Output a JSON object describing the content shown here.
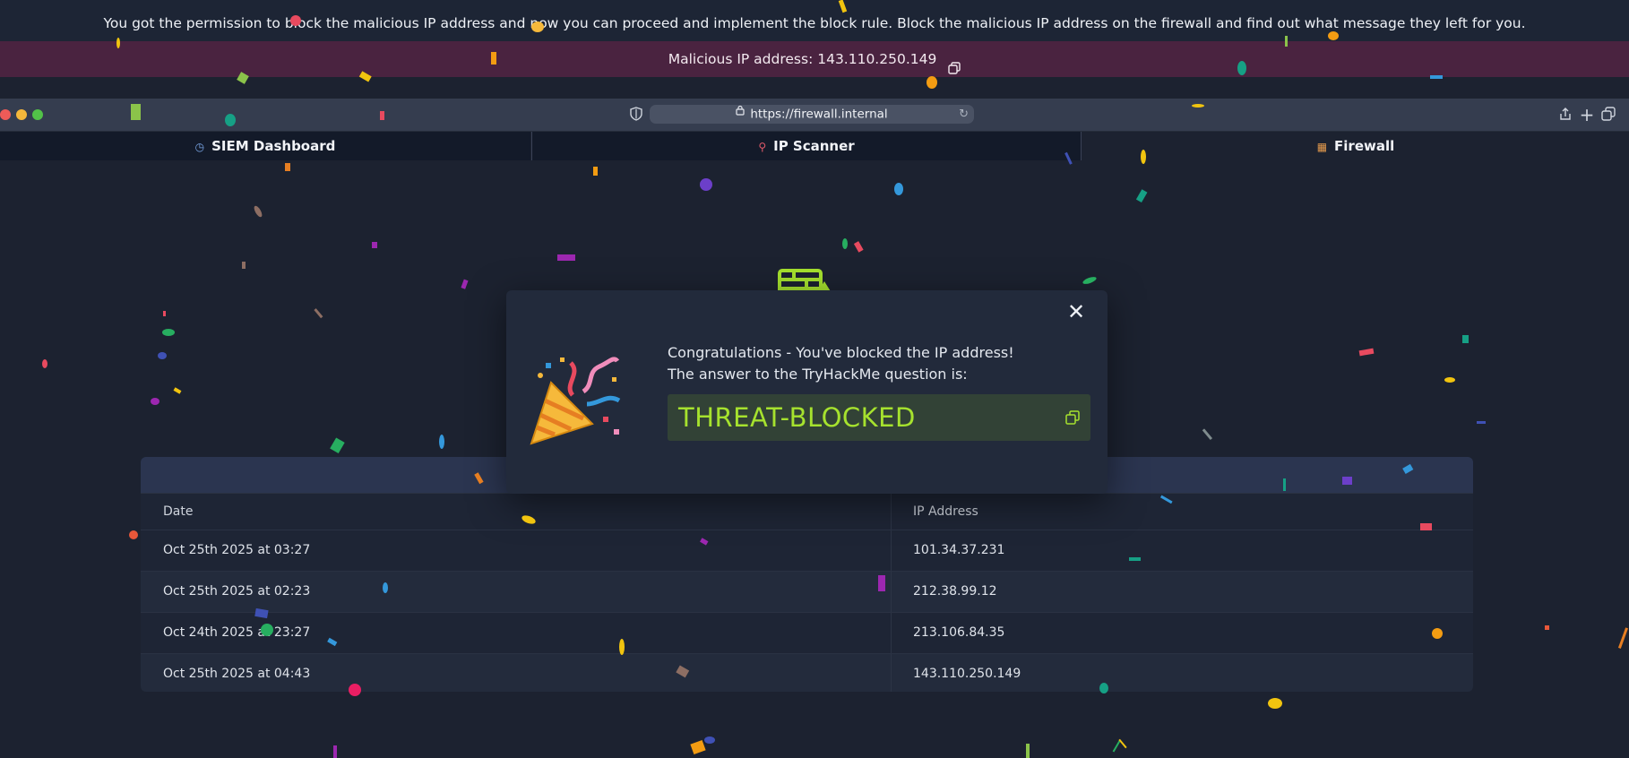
{
  "instructions": "You got the permission to block the malicious IP address and now you can proceed and implement the block rule. Block the malicious IP address on the firewall and find out what message they left for you.",
  "malicious_ip": {
    "label": "Malicious IP address: 143.110.250.149",
    "copy_icon": "copy-icon"
  },
  "browser": {
    "url": "https://firewall.internal",
    "icons": [
      "shield-icon",
      "lock-icon",
      "reload-icon",
      "share-icon",
      "new-tab-icon",
      "tabs-icon"
    ]
  },
  "tabs": [
    {
      "label": "SIEM Dashboard",
      "icon": "clock-icon",
      "active": false
    },
    {
      "label": "IP Scanner",
      "icon": "search-icon",
      "active": false
    },
    {
      "label": "Firewall",
      "icon": "firewall-icon",
      "active": true
    }
  ],
  "table": {
    "columns": [
      "Date",
      "IP Address"
    ],
    "rows": [
      {
        "date": "Oct 25th 2025 at 03:27",
        "ip": "101.34.37.231"
      },
      {
        "date": "Oct 25th 2025 at 02:23",
        "ip": "212.38.99.12"
      },
      {
        "date": "Oct 24th 2025 at 23:27",
        "ip": "213.106.84.35"
      },
      {
        "date": "Oct 25th 2025 at 04:43",
        "ip": "143.110.250.149"
      }
    ]
  },
  "modal": {
    "line1": "Congratulations - You've blocked the IP address!",
    "line2": "The answer to the TryHackMe question is:",
    "answer": "THREAT-BLOCKED",
    "icon": "party-popper-icon"
  },
  "colors": {
    "answer_text": "#a6e22e",
    "ip_banner": "#4a2340",
    "accent": "#a6e22e"
  }
}
